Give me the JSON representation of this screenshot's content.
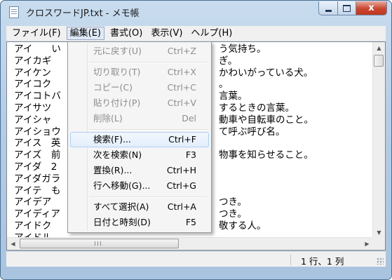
{
  "window": {
    "title": "クロスワードJP.txt - メモ帳",
    "buttons": {
      "close_label": "x"
    }
  },
  "menubar": {
    "items": [
      "ファイル(F)",
      "編集(E)",
      "書式(O)",
      "表示(V)",
      "ヘルプ(H)"
    ],
    "active_index": 1
  },
  "editor": {
    "lines": [
      "アイ　　い",
      "アイカギ",
      "アイケン",
      "アイコク",
      "アイコトバ",
      "アイサツ",
      "アイシャ",
      "アイショウ",
      "アイス　英",
      "アイズ　前",
      "アイダ　2",
      "アイダガラ",
      "アイテ　も",
      "アイデア",
      "アイディア",
      "アイドク",
      "アイドル"
    ],
    "visible_right_fragments": [
      "う気持ち。",
      "ぎ。",
      "かわいがっている犬。",
      "。",
      "言葉。",
      "するときの言葉。",
      "動車や自転車のこと。",
      "て呼ぶ呼び名。",
      "物事を知らせること。",
      "つき。",
      "つき。",
      "敬する人。"
    ]
  },
  "edit_menu": {
    "items": [
      {
        "label": "元に戻す(U)",
        "shortcut": "Ctrl+Z",
        "enabled": false
      },
      {
        "label": "切り取り(T)",
        "shortcut": "Ctrl+X",
        "enabled": false
      },
      {
        "label": "コピー(C)",
        "shortcut": "Ctrl+C",
        "enabled": false
      },
      {
        "label": "貼り付け(P)",
        "shortcut": "Ctrl+V",
        "enabled": false
      },
      {
        "label": "削除(L)",
        "shortcut": "Del",
        "enabled": false
      },
      {
        "label": "検索(F)...",
        "shortcut": "Ctrl+F",
        "enabled": true,
        "highlighted": true
      },
      {
        "label": "次を検索(N)",
        "shortcut": "F3",
        "enabled": true
      },
      {
        "label": "置換(R)...",
        "shortcut": "Ctrl+H",
        "enabled": true
      },
      {
        "label": "行へ移動(G)...",
        "shortcut": "Ctrl+G",
        "enabled": true
      },
      {
        "label": "すべて選択(A)",
        "shortcut": "Ctrl+A",
        "enabled": true
      },
      {
        "label": "日付と時刻(D)",
        "shortcut": "F5",
        "enabled": true
      }
    ]
  },
  "statusbar": {
    "position": "1 行、1 列"
  },
  "colors": {
    "frame": "#b5cde6",
    "close_button": "#c9452f",
    "menu_highlight_border": "#aecff7",
    "disabled_text": "#8d8d8d"
  },
  "icons": {
    "app": "notepad-icon",
    "minimize": "minimize-icon",
    "maximize": "maximize-icon",
    "close": "close-icon"
  }
}
